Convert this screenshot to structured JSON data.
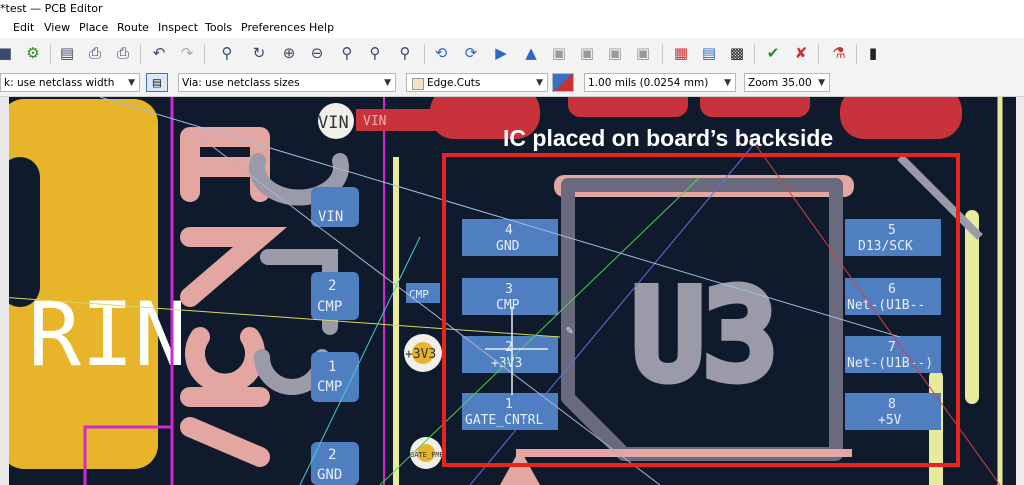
{
  "window": {
    "title": "*test — PCB Editor"
  },
  "menu": [
    "Edit",
    "View",
    "Place",
    "Route",
    "Inspect",
    "Tools",
    "Preferences",
    "Help"
  ],
  "toolbar": {
    "icons": [
      "save-icon",
      "board-setup-icon",
      "page-settings-icon",
      "print-icon",
      "plot-icon",
      "undo-icon",
      "redo-icon",
      "find-icon",
      "refresh-icon",
      "zoom-in-icon",
      "zoom-out-icon",
      "zoom-fit-icon",
      "zoom-objects-icon",
      "zoom-selection-icon",
      "rotate-ccw-icon",
      "rotate-cw-icon",
      "flip-icon",
      "mirror-icon",
      "group-icon",
      "ungroup-icon",
      "lock-icon",
      "unlock-icon",
      "netlist-icon",
      "footprint-library-icon",
      "footprint-editor-icon",
      "drc-icon",
      "erc-icon",
      "scripting-icon",
      "console-icon"
    ]
  },
  "options": {
    "track_width": "k: use netclass width",
    "via_size": "Via: use netclass sizes",
    "layer": "Edge.Cuts",
    "grid": "1.00 mils (0.0254 mm)",
    "zoom": "Zoom 35.00"
  },
  "canvas": {
    "annotation": "IC placed on board’s backside",
    "reference": "U3",
    "left_pads": [
      {
        "num": "4",
        "net": "GND"
      },
      {
        "num": "3",
        "net": "CMP"
      },
      {
        "num": "2",
        "net": "+3V3"
      },
      {
        "num": "1",
        "net": "GATE_CNTRL"
      }
    ],
    "right_pads": [
      {
        "num": "5",
        "net": "D13/SCK"
      },
      {
        "num": "6",
        "net": "Net-(U1B--"
      },
      {
        "num": "7",
        "net": "Net-(U1B--)"
      },
      {
        "num": "8",
        "net": "+5V"
      }
    ],
    "vin_label": "VIN",
    "vin_net": "VIN",
    "pad_vin_text": "VIN",
    "pad2_num": "2",
    "pad2_net": "CMP",
    "pad1_num": "1",
    "pad1_net": "CMP",
    "pad_gnd_num": "2",
    "pad_gnd_net": "GND",
    "cmp_small": "CMP",
    "v3_label": "+3V3",
    "gate_small": "GATE_FMR",
    "silk_rin": "RIN",
    "colors": {
      "board": "#0f1a2c",
      "pad_blue": "#4f7fc0",
      "copper_red": "#c8323a",
      "silk_pink": "#e4a6a0",
      "fab_gray": "#8f8f9f",
      "highlight_red": "#e8241f",
      "yellow": "#e6ec9b",
      "edge_magenta": "#d028d0",
      "gold": "#e8b42a"
    }
  }
}
